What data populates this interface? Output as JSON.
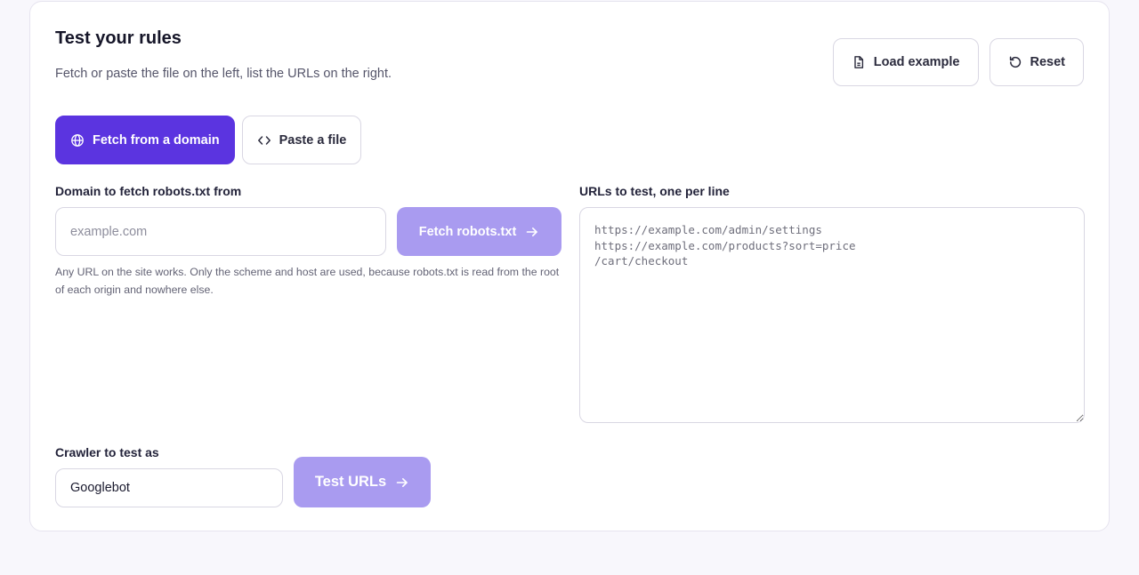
{
  "panel": {
    "title": "Test your rules",
    "subtitle": "Fetch or paste the file on the left, list the URLs on the right."
  },
  "actions": {
    "load_example_label": "Load example",
    "reset_label": "Reset"
  },
  "mode_tabs": [
    {
      "label": "Fetch from a domain",
      "icon": "globe-icon",
      "active": true
    },
    {
      "label": "Paste a file",
      "icon": "code-icon",
      "active": false
    }
  ],
  "domain": {
    "label": "Domain to fetch robots.txt from",
    "placeholder": "example.com",
    "value": "",
    "fetch_button_label": "Fetch robots.txt",
    "hint": "Any URL on the site works. Only the scheme and host are used, because robots.txt is read from the root of each origin and nowhere else."
  },
  "urls": {
    "label": "URLs to test, one per line",
    "placeholder": "https://example.com/admin/settings\nhttps://example.com/products?sort=price\n/cart/checkout"
  },
  "crawler": {
    "label": "Crawler to test as",
    "value": "Googlebot",
    "test_button_label": "Test URLs"
  },
  "colors": {
    "accent": "#5b34e0",
    "accent_disabled": "#a99bf0",
    "page_background": "#f8f7fc"
  }
}
